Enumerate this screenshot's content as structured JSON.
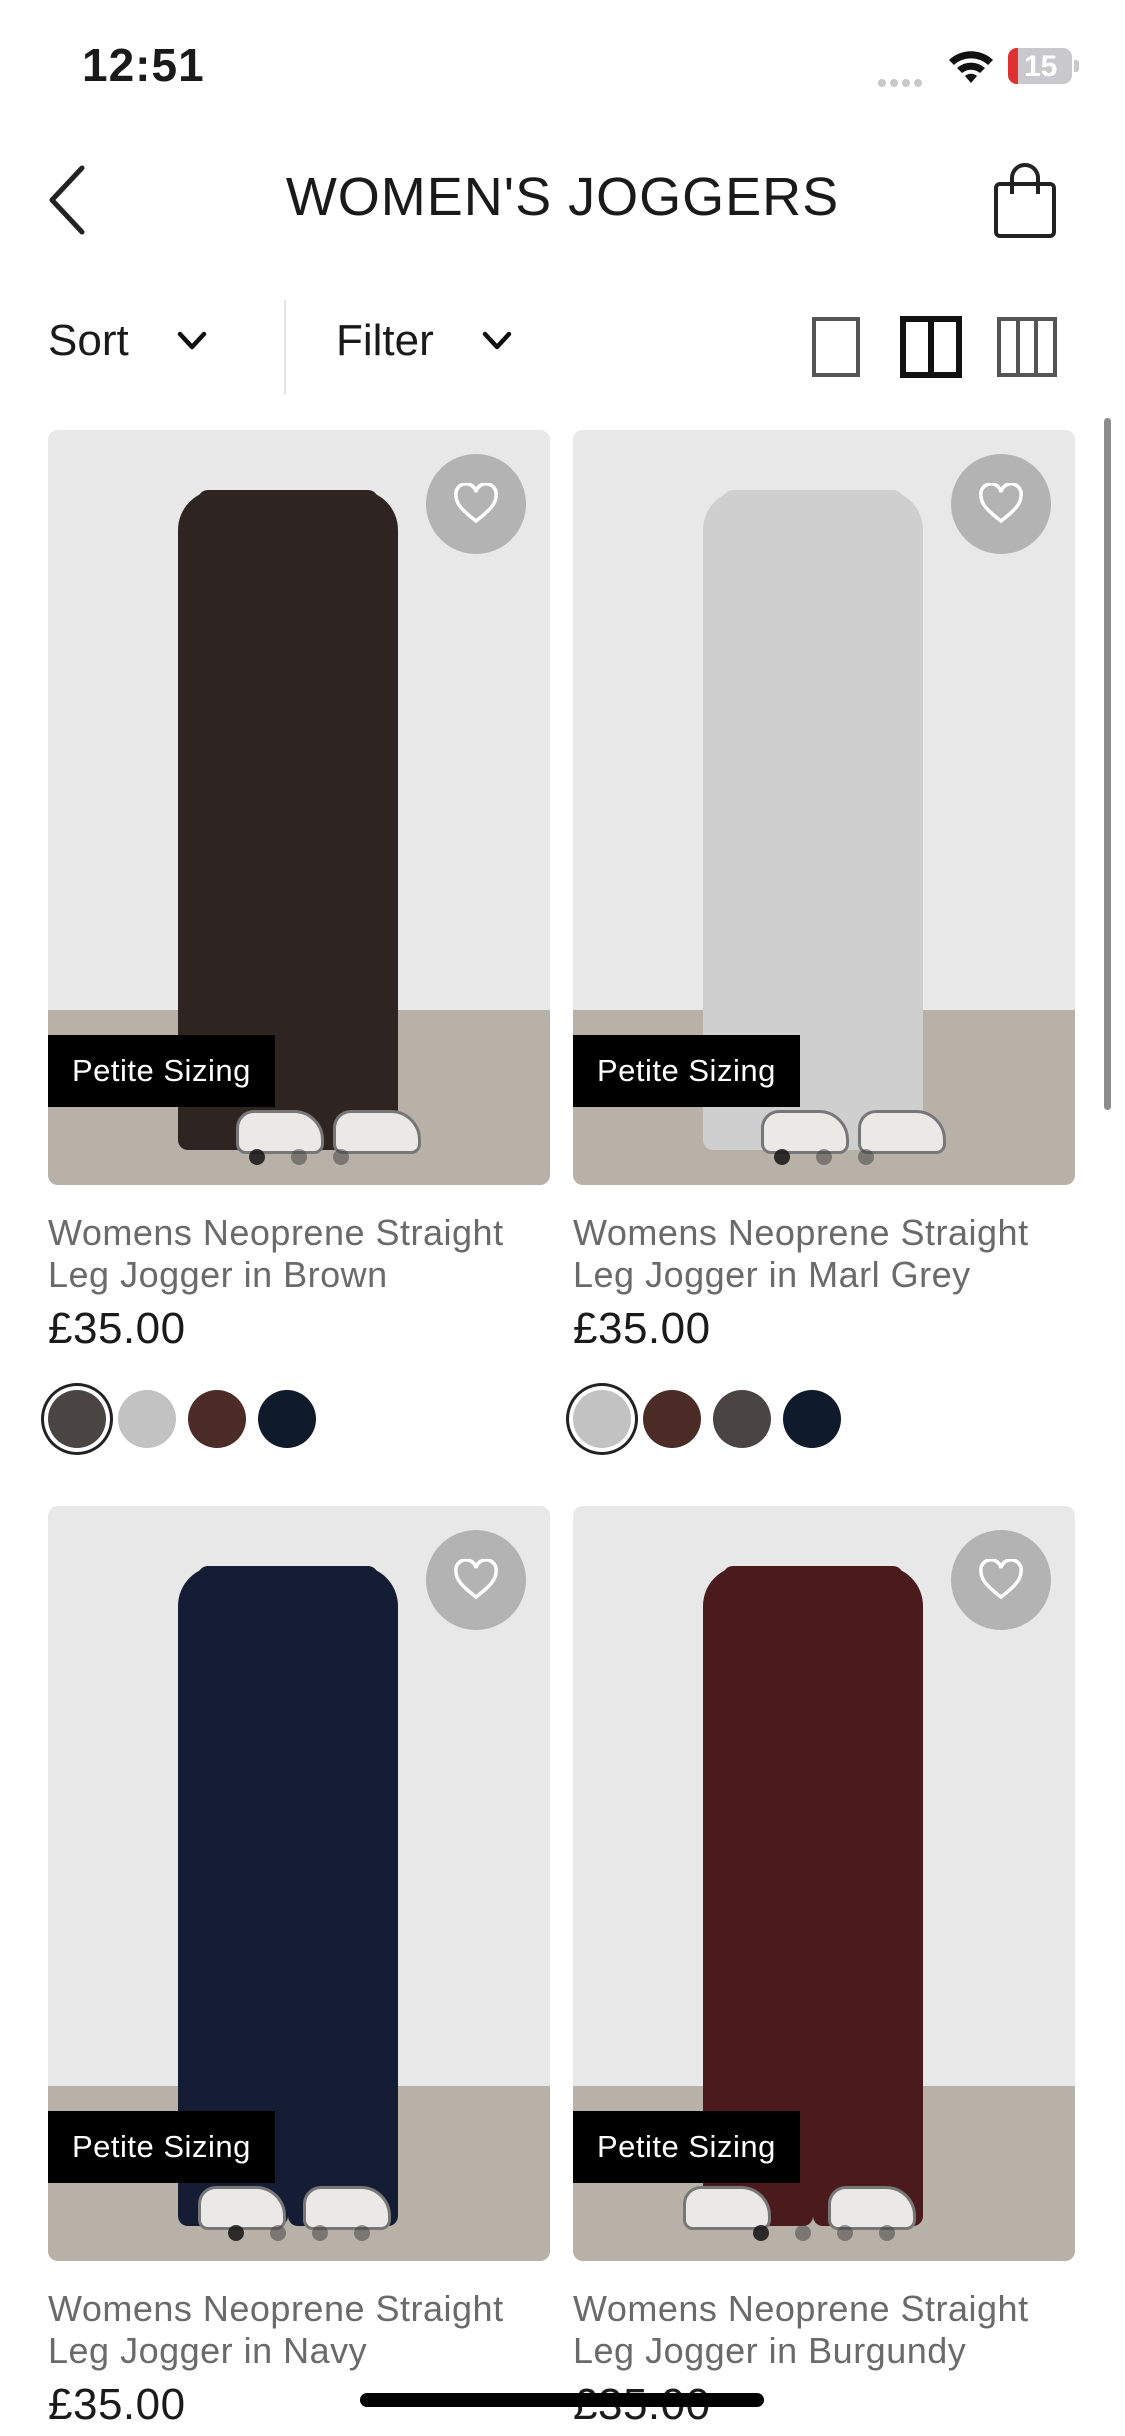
{
  "status_bar": {
    "time": "12:51",
    "battery": "15",
    "battery_level": 0.15
  },
  "header": {
    "title": "WOMEN'S JOGGERS"
  },
  "toolbar": {
    "sort_label": "Sort",
    "filter_label": "Filter"
  },
  "products": [
    {
      "name": "Womens Neoprene Straight Leg Jogger in Brown",
      "price": "£35.00",
      "badge": "Petite Sizing",
      "color": "#2e2422",
      "swatches": [
        "#4a4443",
        "#c2c2c2",
        "#4b2c26",
        "#0f1a2a"
      ],
      "selected_swatch": 0
    },
    {
      "name": "Womens Neoprene Straight Leg Jogger in Marl Grey",
      "price": "£35.00",
      "badge": "Petite Sizing",
      "color": "#cfcfcf",
      "swatches": [
        "#c2c2c2",
        "#4b2c26",
        "#4a4443",
        "#0f1a2a"
      ],
      "selected_swatch": 0
    },
    {
      "name": "Womens Neoprene Straight Leg Jogger in Navy",
      "price": "£35.00",
      "badge": "Petite Sizing",
      "color": "#141d33",
      "swatches": [],
      "selected_swatch": null
    },
    {
      "name": "Womens Neoprene Straight Leg Jogger in Burgundy",
      "price": "£35.00",
      "badge": "Petite Sizing",
      "color": "#4a1a1c",
      "swatches": [],
      "selected_swatch": null
    }
  ]
}
